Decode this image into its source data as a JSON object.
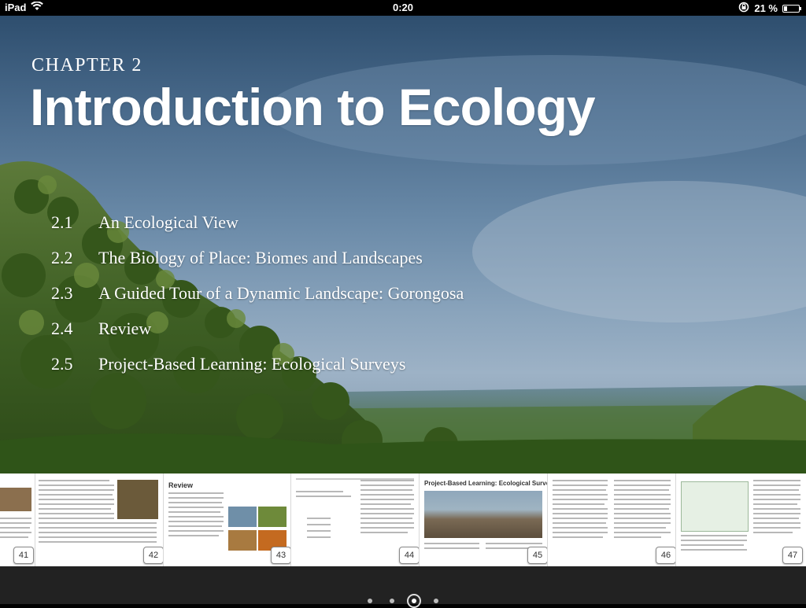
{
  "status_bar": {
    "device": "iPad",
    "time": "0:20",
    "battery": "21 %",
    "battery_fraction": 0.21
  },
  "chapter": {
    "label": "CHAPTER 2",
    "title": "Introduction to Ecology",
    "sections": [
      {
        "num": "2.1",
        "title": "An Ecological View"
      },
      {
        "num": "2.2",
        "title": "The Biology of Place: Biomes and Landscapes"
      },
      {
        "num": "2.3",
        "title": "A Guided Tour of a Dynamic Landscape: Gorongosa"
      },
      {
        "num": "2.4",
        "title": "Review"
      },
      {
        "num": "2.5",
        "title": "Project-Based Learning: Ecological Surveys"
      }
    ]
  },
  "thumbnails": {
    "pages": [
      "41",
      "42",
      "43",
      "44",
      "45",
      "46",
      "47"
    ],
    "review_heading": "Review",
    "pbl_heading": "Project-Based Learning: Ecological Surveys"
  },
  "page_indicator": {
    "count": 4,
    "active": 3
  }
}
